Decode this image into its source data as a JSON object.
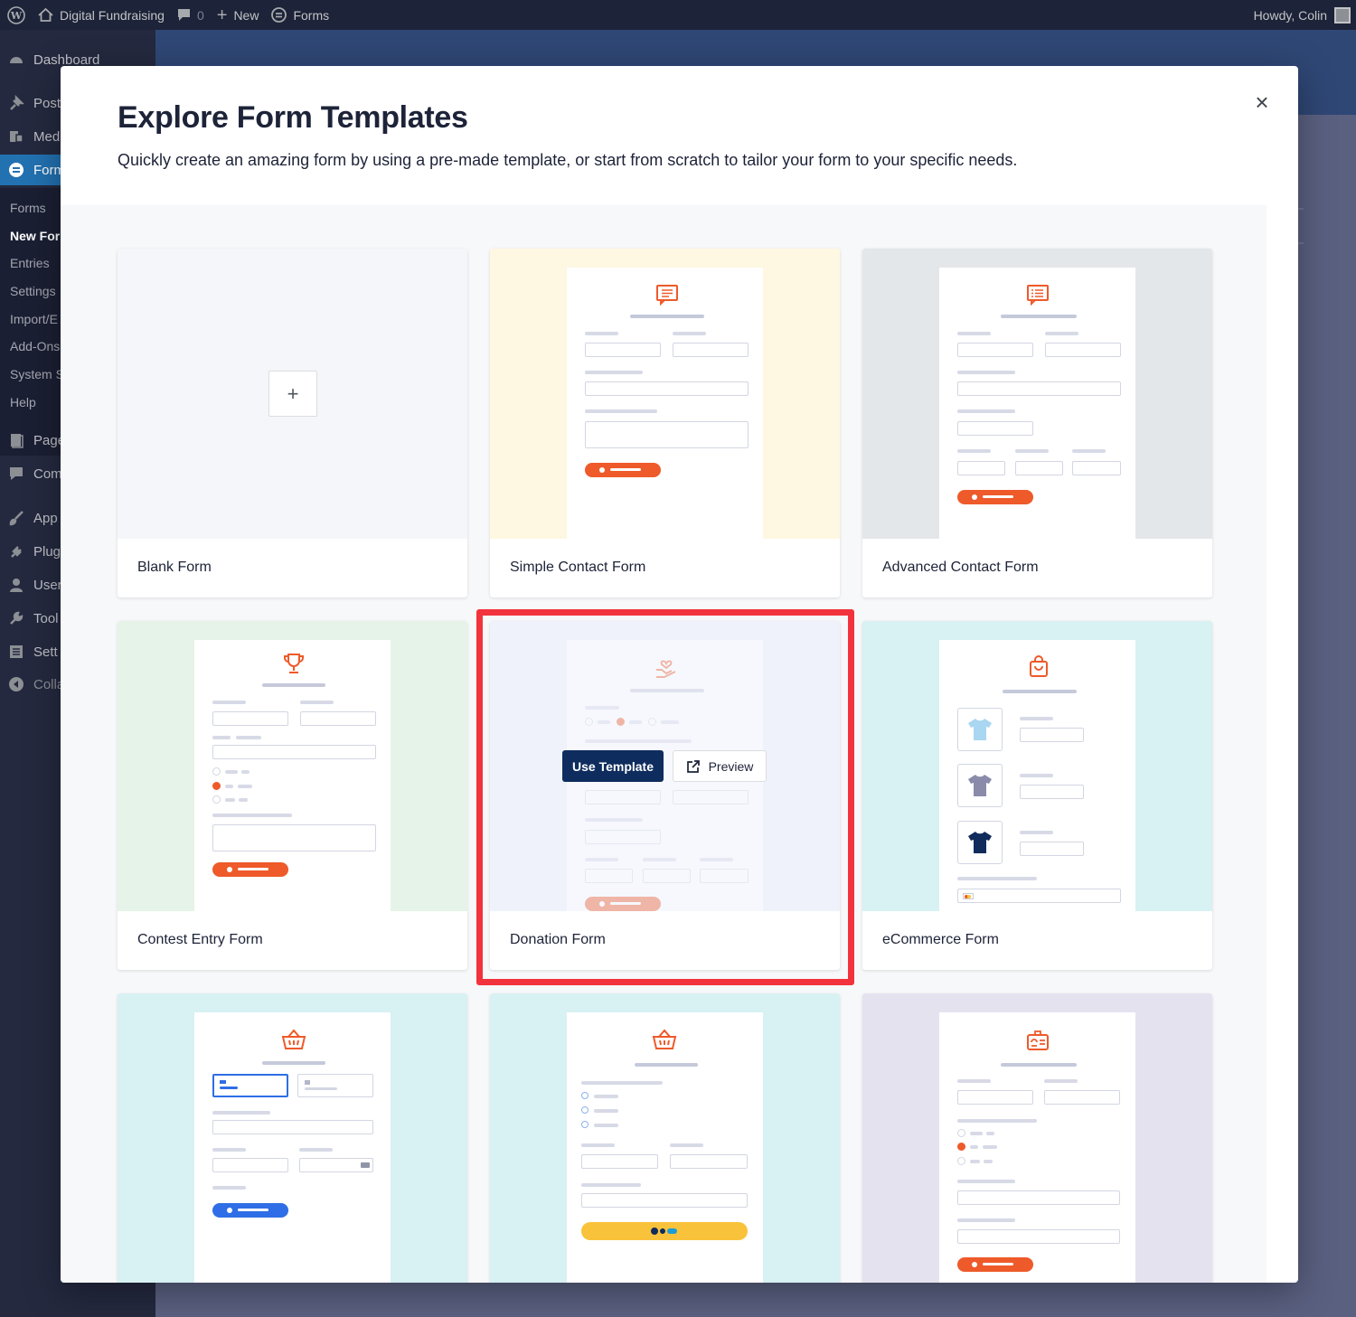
{
  "adminbar": {
    "site_name": "Digital Fundraising",
    "comments_count": "0",
    "new_label": "New",
    "forms_label": "Forms",
    "howdy": "Howdy, Colin"
  },
  "sidebar": {
    "dashboard": "Dashboard",
    "posts": "Post",
    "media": "Med",
    "forms": "Form",
    "sub": [
      "Forms",
      "New For",
      "Entries",
      "Settings",
      "Import/E",
      "Add-Ons",
      "System S",
      "Help"
    ],
    "pages": "Page",
    "comments": "Com",
    "appearance": "App",
    "plugins": "Plug",
    "users": "User",
    "tools": "Tool",
    "settings": "Sett",
    "collapse": "Colla"
  },
  "modal": {
    "title": "Explore Form Templates",
    "subtitle": "Quickly create an amazing form by using a pre-made template, or start from scratch to tailor your form to your specific needs.",
    "close": "×"
  },
  "templates": [
    {
      "name": "Blank Form",
      "bg": "#f5f6f9"
    },
    {
      "name": "Simple Contact Form",
      "bg": "#fef7e1"
    },
    {
      "name": "Advanced Contact Form",
      "bg": "#e4e7ea"
    },
    {
      "name": "Contest Entry Form",
      "bg": "#e6f3e8"
    },
    {
      "name": "Donation Form",
      "bg": "#eef1fb"
    },
    {
      "name": "eCommerce Form",
      "bg": "#d8f1f3"
    },
    {
      "name": "",
      "bg": "#d8f1f3"
    },
    {
      "name": "",
      "bg": "#d8f1f3"
    },
    {
      "name": "",
      "bg": "#e5e2f0"
    }
  ],
  "hover": {
    "use_template": "Use Template",
    "preview": "Preview"
  },
  "colors": {
    "accent_orange": "#ee5a2a",
    "navy": "#0e2c5e",
    "highlight_red": "#f2333d"
  }
}
